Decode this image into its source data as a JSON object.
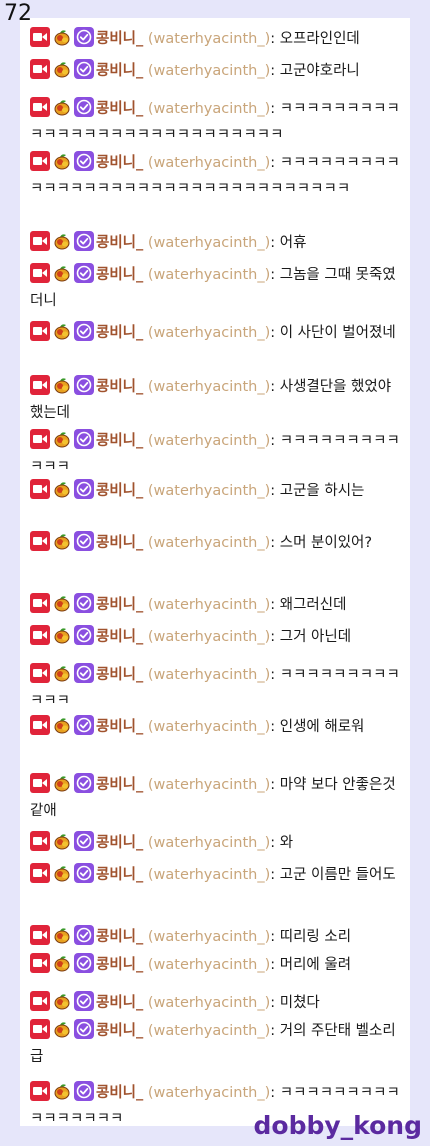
{
  "page_number": "72",
  "watermark": "dobby_kong",
  "user": {
    "display_name": "콩비니_",
    "login": "(waterhyacinth_)",
    "separator": ":"
  },
  "badges": [
    "video-camera-badge-icon",
    "fruit-badge-icon",
    "verified-badge-icon"
  ],
  "colors": {
    "background": "#e6e6fa",
    "panel": "#ffffff",
    "username": "#a0522d",
    "login": "#c9a57a",
    "watermark": "#5b2aa0",
    "live_badge": "#e0243a",
    "verified_badge": "#8a4fe0"
  },
  "messages": [
    {
      "text": "오프라인인데"
    },
    {
      "text": "고군야호라니"
    },
    {
      "text": "ㅋㅋㅋㅋㅋㅋㅋㅋㅋㅋㅋㅋㅋㅋㅋㅋㅋㅋㅋㅋㅋㅋㅋㅋㅋㅋㅋㅋ"
    },
    {
      "text": "ㅋㅋㅋㅋㅋㅋㅋㅋㅋㅋㅋㅋㅋㅋㅋㅋㅋㅋㅋㅋㅋㅋㅋㅋㅋㅋㅋㅋㅋㅋㅋㅋㅋ"
    },
    {
      "text": "어휴"
    },
    {
      "text": "그놈을 그때 못죽였더니"
    },
    {
      "text": "이 사단이 벌어졌네"
    },
    {
      "text": "사생결단을 했었야했는데"
    },
    {
      "text": "ㅋㅋㅋㅋㅋㅋㅋㅋㅋㅋㅋㅋ"
    },
    {
      "text": "고군을 하시는"
    },
    {
      "text": "스머 분이있어?"
    },
    {
      "text": "왜그러신데"
    },
    {
      "text": "그거 아닌데"
    },
    {
      "text": "ㅋㅋㅋㅋㅋㅋㅋㅋㅋㅋㅋㅋ"
    },
    {
      "text": "인생에 해로워"
    },
    {
      "text": "마약 보다 안좋은것같애"
    },
    {
      "text": "와"
    },
    {
      "text": "고군 이름만 들어도"
    },
    {
      "text": "띠리링 소리"
    },
    {
      "text": "머리에 울려"
    },
    {
      "text": "미쳤다"
    },
    {
      "text": "거의 주단태 벨소리급"
    },
    {
      "text": "ㅋㅋㅋㅋㅋㅋㅋㅋㅋㅋㅋㅋㅋㅋㅋㅋ"
    }
  ]
}
